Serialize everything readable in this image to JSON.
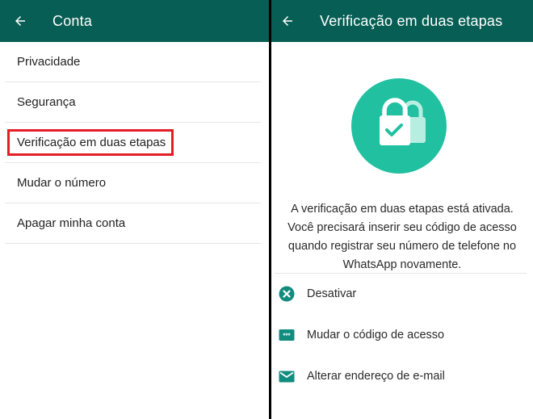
{
  "left": {
    "appbar": {
      "title": "Conta",
      "back_icon": "arrow-left-icon"
    },
    "items": [
      {
        "label": "Privacidade"
      },
      {
        "label": "Segurança"
      },
      {
        "label": "Verificação em duas etapas",
        "highlighted": true
      },
      {
        "label": "Mudar o número"
      },
      {
        "label": "Apagar minha conta"
      }
    ]
  },
  "right": {
    "appbar": {
      "title": "Verificação em duas etapas",
      "back_icon": "arrow-left-icon"
    },
    "illustration": {
      "icon": "padlock-check-icon",
      "color": "#20c0a0"
    },
    "description": "A verificação em duas etapas está ativada. Você precisará inserir seu código de acesso quando registrar seu número de telefone no WhatsApp novamente.",
    "options": [
      {
        "label": "Desativar",
        "icon": "close-circle-icon"
      },
      {
        "label": "Mudar o código de acesso",
        "icon": "password-icon"
      },
      {
        "label": "Alterar endereço de e-mail",
        "icon": "email-icon"
      }
    ]
  },
  "colors": {
    "appbar": "#075e54",
    "accent": "#20c0a0",
    "icon_teal": "#128c7e",
    "highlight": "#e31e24"
  }
}
